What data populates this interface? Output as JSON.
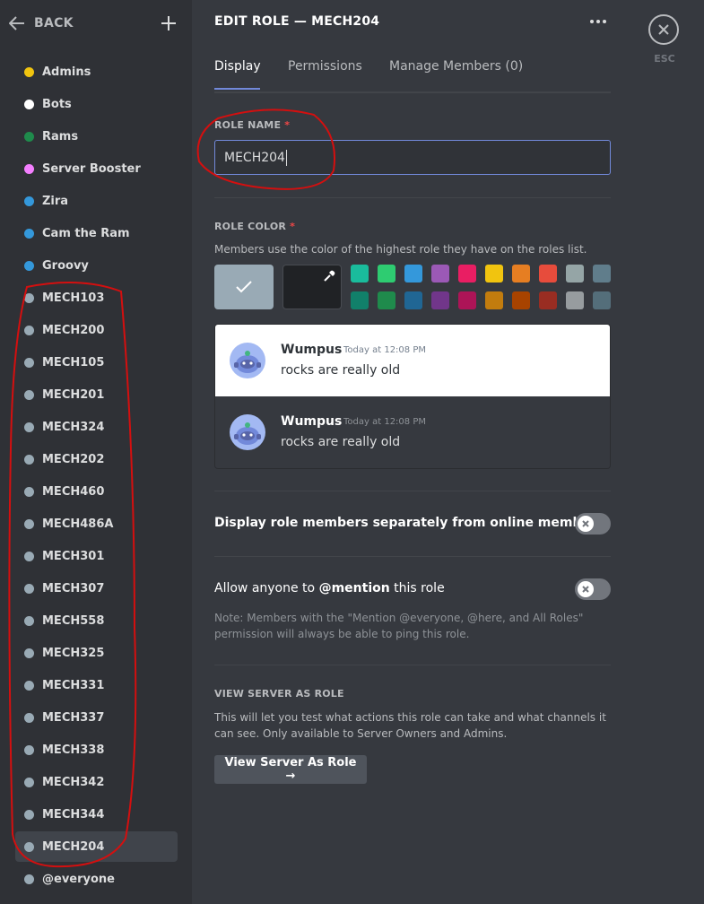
{
  "sidebar": {
    "back_label": "BACK",
    "roles": [
      {
        "name": "Admins",
        "color": "#f1c40f"
      },
      {
        "name": "Bots",
        "color": "#ffffff"
      },
      {
        "name": "Rams",
        "color": "#1f8b4c"
      },
      {
        "name": "Server Booster",
        "color": "#f47fff"
      },
      {
        "name": "Zira",
        "color": "#3498db"
      },
      {
        "name": "Cam the Ram",
        "color": "#3498db"
      },
      {
        "name": "Groovy",
        "color": "#3498db"
      },
      {
        "name": "MECH103",
        "color": "#99aab5"
      },
      {
        "name": "MECH200",
        "color": "#99aab5"
      },
      {
        "name": "MECH105",
        "color": "#99aab5"
      },
      {
        "name": "MECH201",
        "color": "#99aab5"
      },
      {
        "name": "MECH324",
        "color": "#99aab5"
      },
      {
        "name": "MECH202",
        "color": "#99aab5"
      },
      {
        "name": "MECH460",
        "color": "#99aab5"
      },
      {
        "name": "MECH486A",
        "color": "#99aab5"
      },
      {
        "name": "MECH301",
        "color": "#99aab5"
      },
      {
        "name": "MECH307",
        "color": "#99aab5"
      },
      {
        "name": "MECH558",
        "color": "#99aab5"
      },
      {
        "name": "MECH325",
        "color": "#99aab5"
      },
      {
        "name": "MECH331",
        "color": "#99aab5"
      },
      {
        "name": "MECH337",
        "color": "#99aab5"
      },
      {
        "name": "MECH338",
        "color": "#99aab5"
      },
      {
        "name": "MECH342",
        "color": "#99aab5"
      },
      {
        "name": "MECH344",
        "color": "#99aab5"
      },
      {
        "name": "MECH204",
        "color": "#99aab5",
        "selected": true
      },
      {
        "name": "@everyone",
        "color": "#99aab5"
      }
    ]
  },
  "header": {
    "title": "EDIT ROLE — MECH204",
    "tabs": [
      "Display",
      "Permissions",
      "Manage Members (0)"
    ],
    "active_tab": "Display",
    "esc_label": "ESC"
  },
  "role_name": {
    "label": "ROLE NAME",
    "required_mark": "*",
    "value": "MECH204"
  },
  "role_color": {
    "label": "ROLE COLOR",
    "required_mark": "*",
    "description": "Members use the color of the highest role they have on the roles list.",
    "default_color": "#99aab5",
    "swatches_top": [
      "#1abc9c",
      "#2ecc71",
      "#3498db",
      "#9b59b6",
      "#e91e63",
      "#f1c40f",
      "#e67e22",
      "#e74c3c",
      "#95a5a6",
      "#607d8b"
    ],
    "swatches_bottom": [
      "#11806a",
      "#1f8b4c",
      "#206694",
      "#71368a",
      "#ad1457",
      "#c27c0e",
      "#a84300",
      "#992d22",
      "#979c9f",
      "#546e7a"
    ]
  },
  "preview": {
    "username": "Wumpus",
    "timestamp": "Today at 12:08 PM",
    "message": "rocks are really old"
  },
  "settings": {
    "hoist_label": "Display role members separately from online members",
    "mention_prefix": "Allow anyone to ",
    "mention_bold": "@mention",
    "mention_suffix": " this role",
    "mention_note": "Note: Members with the \"Mention @everyone, @here, and All Roles\" permission will always be able to ping this role."
  },
  "view_as": {
    "label": "VIEW SERVER AS ROLE",
    "description": "This will let you test what actions this role can take and what channels it can see. Only available to Server Owners and Admins.",
    "button_label": "View Server As Role →"
  }
}
